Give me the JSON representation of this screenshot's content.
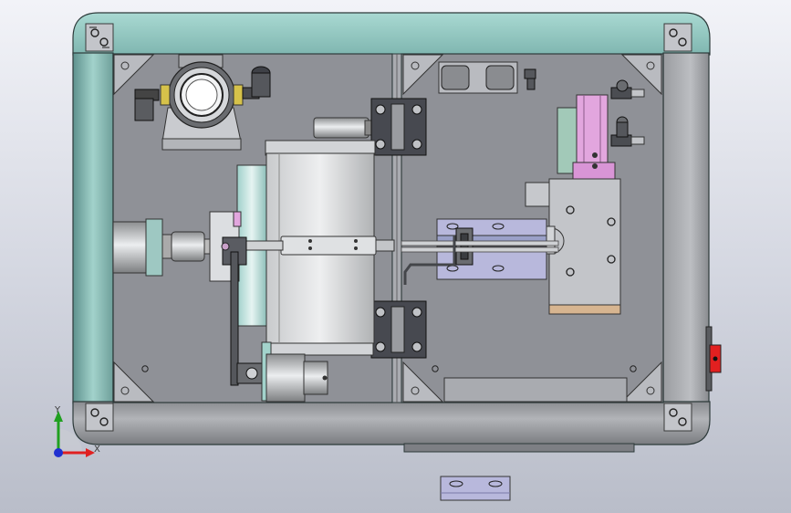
{
  "viewport": {
    "background": "gradient-light-gray",
    "triad": {
      "x_label": "X",
      "y_label": "Y",
      "x_color": "#e02020",
      "y_color": "#20a020",
      "z_color": "#2030d0"
    }
  },
  "colors": {
    "frame_teal": "#9fcfc9",
    "frame_gray": "#b6b8bc",
    "panel_gray": "#8e9096",
    "cylinder_pink": "#e2a6de",
    "bracket_blue": "#b8b8dc",
    "red_button": "#e22020",
    "bronze": "#d7b590"
  },
  "icons": [
    "corner-gusset-icon",
    "hinge-icon",
    "fitting-icon",
    "triad-icon"
  ]
}
